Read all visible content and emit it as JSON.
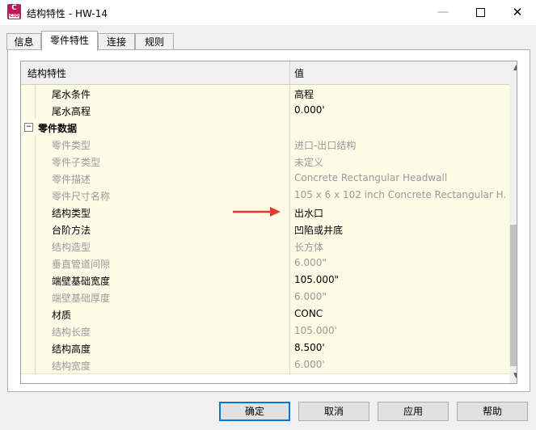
{
  "window": {
    "title": "结构特性 - HW-14",
    "icon_text": "C",
    "icon_subtext": "C3D",
    "min_glyph": "—",
    "close_glyph": "✕"
  },
  "tabs": [
    "信息",
    "零件特性",
    "连接",
    "规则"
  ],
  "active_tab": "零件特性",
  "grid": {
    "header_name": "结构特性",
    "header_value": "值",
    "rows": [
      {
        "name": "尾水条件",
        "value": "高程",
        "disabled": false
      },
      {
        "name": "尾水高程",
        "value": "0.000'",
        "disabled": false
      },
      {
        "name": "零件数据",
        "value": "",
        "section": true,
        "expander": "−"
      },
      {
        "name": "零件类型",
        "value": "进口-出口结构",
        "disabled": true
      },
      {
        "name": "零件子类型",
        "value": "未定义",
        "disabled": true
      },
      {
        "name": "零件描述",
        "value": "Concrete Rectangular Headwall",
        "disabled": true
      },
      {
        "name": "零件尺寸名称",
        "value": "105 x 6 x 102 inch Concrete Rectangular H...",
        "disabled": true
      },
      {
        "name": "结构类型",
        "value": "出水口",
        "disabled": false
      },
      {
        "name": "台阶方法",
        "value": "凹陷或井底",
        "disabled": false
      },
      {
        "name": "结构造型",
        "value": "长方体",
        "disabled": true
      },
      {
        "name": "垂直管道间隙",
        "value": "6.000\"",
        "disabled": true
      },
      {
        "name": "端壁基础宽度",
        "value": "105.000\"",
        "disabled": false
      },
      {
        "name": "端壁基础厚度",
        "value": "6.000\"",
        "disabled": true
      },
      {
        "name": "材质",
        "value": "CONC",
        "disabled": false
      },
      {
        "name": "结构长度",
        "value": "105.000'",
        "disabled": true
      },
      {
        "name": "结构高度",
        "value": "8.500'",
        "disabled": false
      },
      {
        "name": "结构宽度",
        "value": "6.000'",
        "disabled": true
      }
    ]
  },
  "scroll": {
    "up_glyph": "▲",
    "down_glyph": "▼"
  },
  "buttons": {
    "ok": "确定",
    "cancel": "取消",
    "apply": "应用",
    "help": "帮助"
  },
  "colors": {
    "row_bg": "#fdfbe6",
    "arrow": "#e53935",
    "default_border": "#0078d7"
  }
}
